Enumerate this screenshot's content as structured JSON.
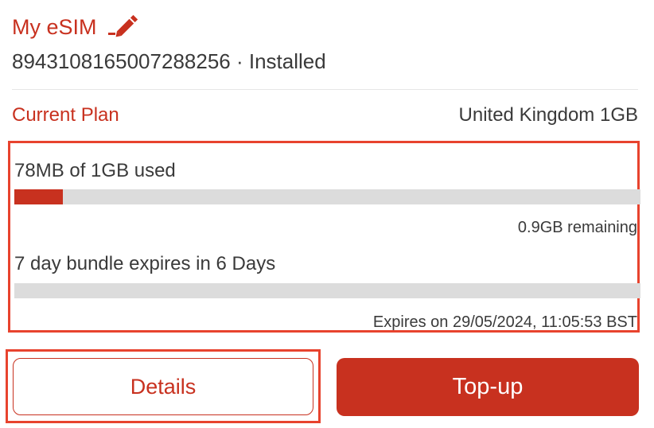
{
  "esim": {
    "title": "My eSIM",
    "iccid_status": "8943108165007288256 · Installed",
    "edit_icon": "pencil-icon"
  },
  "plan": {
    "label": "Current Plan",
    "value": "United Kingdom 1GB"
  },
  "usage": {
    "data_used_text": "78MB of 1GB used",
    "data_used_fraction": 0.078,
    "data_remaining_text": "0.9GB remaining",
    "bundle_text": "7 day bundle expires in 6 Days",
    "bundle_elapsed_fraction": 0.0,
    "expiry_text": "Expires on 29/05/2024, 11:05:53 BST"
  },
  "actions": {
    "details_label": "Details",
    "topup_label": "Top-up"
  },
  "colors": {
    "accent": "#c8311f",
    "highlight_border": "#e8432e",
    "bar_track": "#dcdcdc"
  }
}
